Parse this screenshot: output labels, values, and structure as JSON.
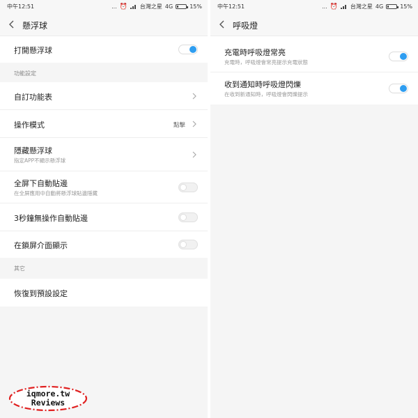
{
  "left": {
    "status": {
      "time": "中午12:51",
      "dots": "...",
      "carrier": "台灣之星",
      "network": "4G",
      "battery": "15%",
      "battery_level": 0.15
    },
    "title": "懸浮球",
    "main_toggle": {
      "label": "打開懸浮球",
      "on": true
    },
    "section_functions": "功能設定",
    "rows": [
      {
        "label": "自訂功能表",
        "type": "link"
      },
      {
        "label": "操作模式",
        "value": "點擊",
        "type": "link"
      },
      {
        "label": "隱藏懸浮球",
        "sub": "指定APP不顯示懸浮球",
        "type": "link"
      },
      {
        "label": "全屏下自動貼邊",
        "sub": "在全屏應用中自動將懸浮球貼邊隱藏",
        "type": "toggle",
        "on": false
      },
      {
        "label": "3秒鐘無操作自動貼邊",
        "type": "toggle",
        "on": false
      },
      {
        "label": "在鎖屏介面顯示",
        "type": "toggle",
        "on": false
      }
    ],
    "section_other": "其它",
    "reset_label": "恢復到預設設定"
  },
  "right": {
    "status": {
      "time": "中午12:51",
      "dots": "...",
      "carrier": "台灣之星",
      "network": "4G",
      "battery": "15%",
      "battery_level": 0.15
    },
    "title": "呼吸燈",
    "rows": [
      {
        "label": "充電時呼吸燈常亮",
        "sub": "充電時，呼吸燈會常亮提示充電狀態",
        "on": true
      },
      {
        "label": "收到通知時呼吸燈閃爍",
        "sub": "在收到新通知時，呼吸燈會閃爍提示",
        "on": true
      }
    ]
  },
  "watermark": {
    "line1": "iqmore.tw",
    "line2": "Reviews",
    "border_color": "#e02020"
  },
  "colors": {
    "accent": "#2e9df0",
    "background": "#f5f5f5"
  }
}
